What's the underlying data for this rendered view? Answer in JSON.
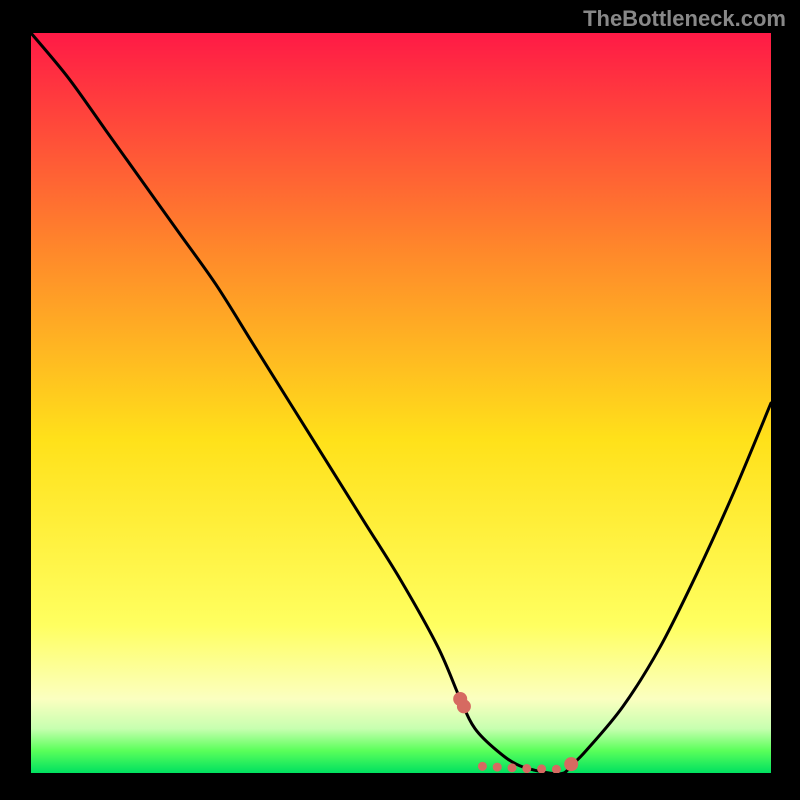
{
  "watermark": "TheBottleneck.com",
  "colors": {
    "background": "#000000",
    "grad_top": "#ff1a46",
    "grad_mid1": "#ff8a2a",
    "grad_mid2": "#ffe11a",
    "grad_y1": "#ffff60",
    "grad_y2": "#fbffc0",
    "grad_g1": "#c7ffb0",
    "grad_g2": "#5aff5a",
    "grad_bottom": "#00e060",
    "curve": "#000000",
    "marker": "#d66a61"
  },
  "chart_data": {
    "type": "line",
    "title": "",
    "xlabel": "",
    "ylabel": "",
    "xlim": [
      0,
      100
    ],
    "ylim": [
      0,
      100
    ],
    "x": [
      0,
      5,
      10,
      15,
      20,
      25,
      30,
      35,
      40,
      45,
      50,
      55,
      58,
      60,
      63,
      66,
      70,
      72,
      73,
      75,
      80,
      85,
      90,
      95,
      100
    ],
    "values": [
      100,
      94,
      87,
      80,
      73,
      66,
      58,
      50,
      42,
      34,
      26,
      17,
      10,
      6,
      3,
      1,
      0,
      0,
      1,
      3,
      9,
      17,
      27,
      38,
      50
    ],
    "markers_x": [
      58.0,
      58.5,
      73.0,
      61,
      63,
      65,
      67,
      69,
      71
    ],
    "markers_y": [
      10.0,
      9.0,
      1.2,
      0.9,
      0.8,
      0.7,
      0.6,
      0.55,
      0.5
    ]
  }
}
